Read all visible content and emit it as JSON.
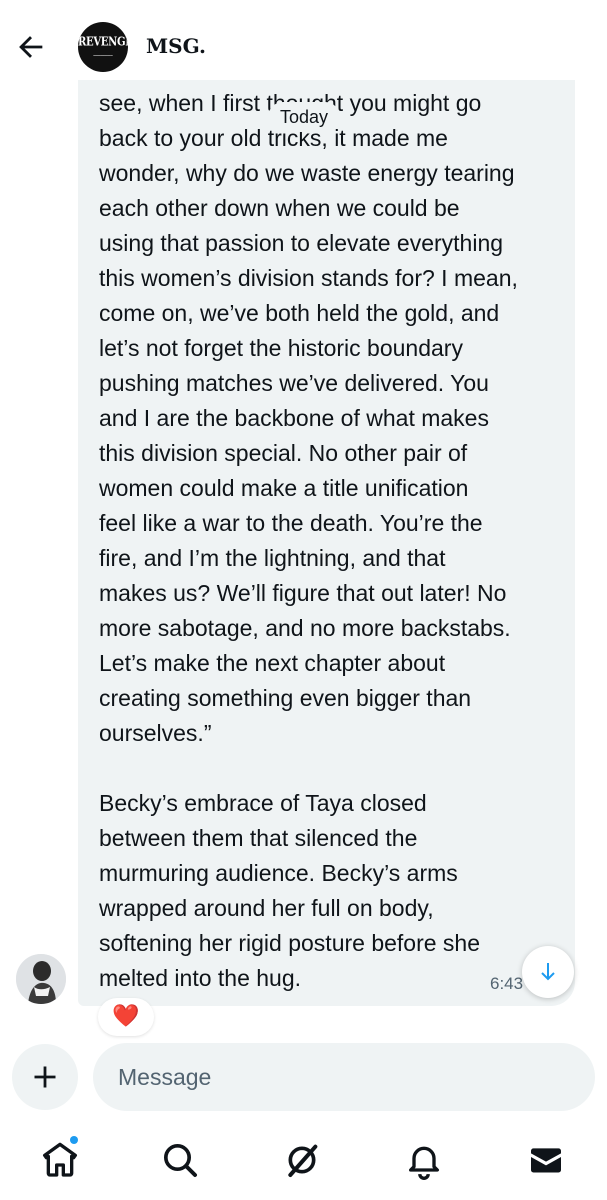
{
  "header": {
    "back_icon": "arrow-left-icon",
    "avatar_logo_text": "REVENGE",
    "name": "MSG."
  },
  "date_chip": "Today",
  "message": {
    "text": "see, when I first thought you might go\nback to your old tricks, it made me\nwonder, why do we waste energy tearing\neach other down when we could be\nusing that passion to elevate everything\nthis women’s division stands for? I mean,\ncome on, we’ve both held the gold, and\nlet’s not forget the historic boundary\npushing matches we’ve delivered. You\nand I are the backbone of what makes\nthis division special. No other pair of\nwomen could make a title unification\nfeel like a war to the death. You’re the\nfire, and I’m the lightning, and that\nmakes us? We’ll figure that out later! No\nmore sabotage, and no more backstabs.\nLet’s make the next chapter about\ncreating something even bigger than\nourselves.”\n\nBecky’s embrace of Taya closed\nbetween them that silenced the\nmurmuring audience. Becky’s arms\nwrapped around her full on body,\nsoftening her rigid posture before she\nmelted into the hug.",
    "time": "6:43",
    "reaction": "❤️"
  },
  "composer": {
    "add_icon": "plus-icon",
    "placeholder": "Message"
  },
  "nav": {
    "items": [
      {
        "icon": "home-icon",
        "has_notification_dot": true
      },
      {
        "icon": "search-icon"
      },
      {
        "icon": "grok-icon"
      },
      {
        "icon": "bell-icon"
      },
      {
        "icon": "mail-icon"
      }
    ]
  },
  "colors": {
    "bubble": "#eff3f4",
    "text": "#0f1419",
    "muted": "#536471",
    "accent": "#1d9bf0",
    "heart": "#f91880"
  }
}
